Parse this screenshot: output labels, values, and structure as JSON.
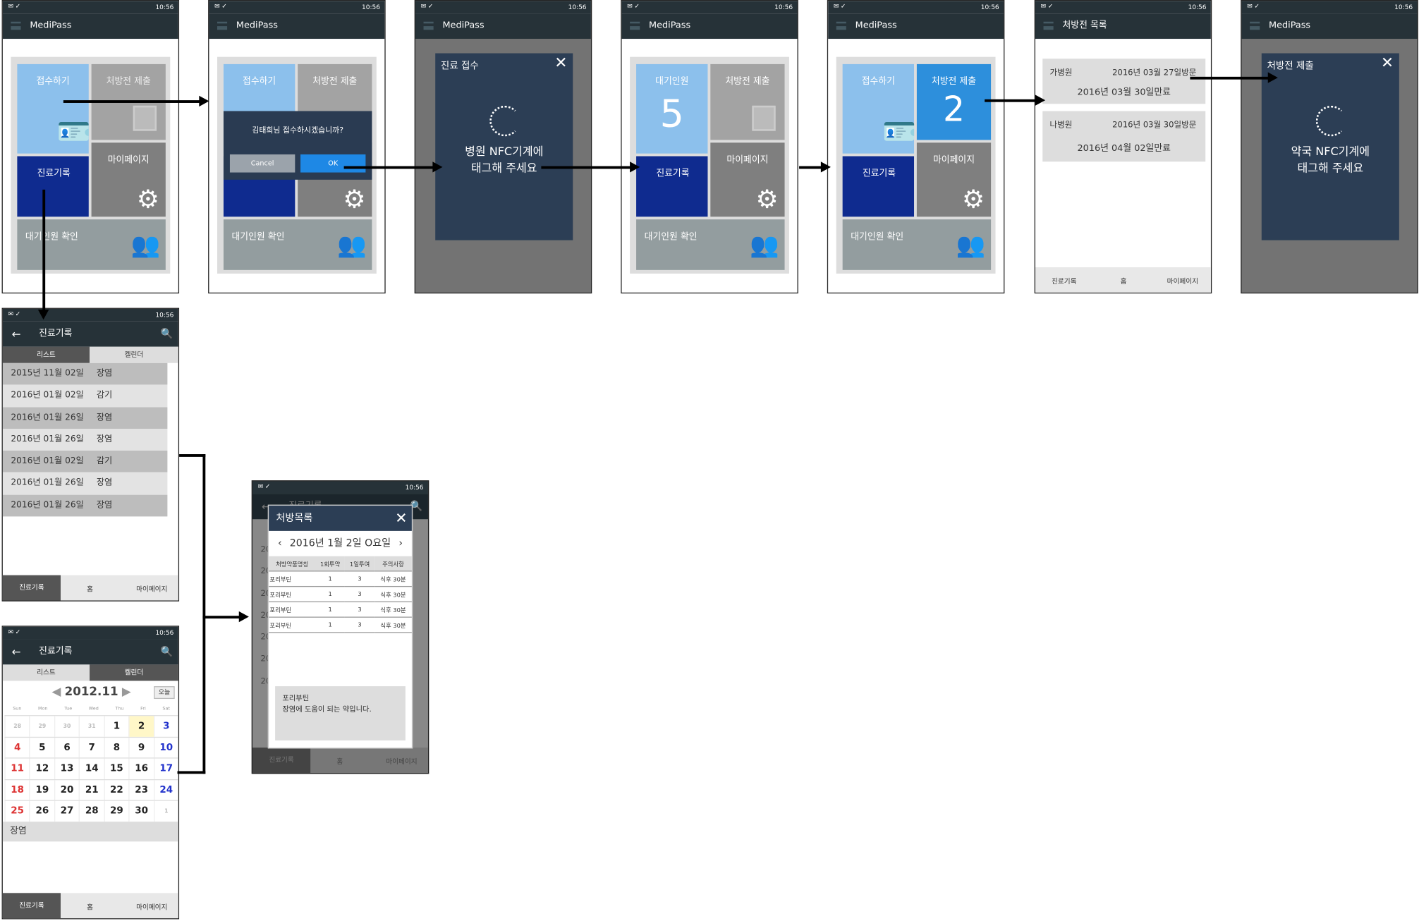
{
  "status_bar": {
    "time": "10:56",
    "left_icons": "✉✓",
    "right_icons": "▼◢ ▮"
  },
  "app": {
    "title": "MediPass"
  },
  "home": {
    "tile_reception": "접수하기",
    "tile_prescription": "처방전 제출",
    "tile_history": "진료기록",
    "tile_mypage": "마이페이지",
    "tile_waiting": "대기인원 확인",
    "tile_waiting_count_label": "대기인원",
    "waiting_count": "5",
    "prescription_count": "2"
  },
  "confirm_dialog": {
    "question": "김태희님 접수하시겠습니까?",
    "cancel": "Cancel",
    "ok": "OK"
  },
  "nfc_hospital": {
    "title": "진료 접수",
    "message_line1": "병원 NFC기계에",
    "message_line2": "태그해 주세요"
  },
  "nfc_pharmacy": {
    "title": "처방전 제출",
    "message_line1": "약국 NFC기계에",
    "message_line2": "태그해 주세요"
  },
  "prescription_list": {
    "title": "처방전 목록",
    "items": [
      {
        "hospital": "가병원",
        "visit": "2016년 03월 27일방문",
        "expire": "2016년 03월 30일만료"
      },
      {
        "hospital": "나병원",
        "visit": "2016년 03월 30일방문",
        "expire": "2016년 04월 02일만료"
      }
    ]
  },
  "bottom_nav": {
    "history": "진료기록",
    "home": "홈",
    "mypage": "마이페이지"
  },
  "history": {
    "title": "진료기록",
    "tab_list": "리스트",
    "tab_calendar": "켈린더",
    "rows": [
      {
        "date": "2015년 11월 02일",
        "diag": "장염"
      },
      {
        "date": "2016년 01월 02일",
        "diag": "감기"
      },
      {
        "date": "2016년 01월 26일",
        "diag": "장염"
      },
      {
        "date": "2016년 01월 26일",
        "diag": "장염"
      },
      {
        "date": "2016년 01월 02일",
        "diag": "감기"
      },
      {
        "date": "2016년 01월 26일",
        "diag": "장염"
      },
      {
        "date": "2016년 01월 26일",
        "diag": "장염"
      }
    ]
  },
  "calendar": {
    "month": "2012.11",
    "today": "오늘",
    "weekdays": [
      "Sun",
      "Mon",
      "Tue",
      "Wed",
      "Thu",
      "Fri",
      "Sat"
    ],
    "weeks": [
      [
        "28",
        "29",
        "30",
        "31",
        "1",
        "2",
        "3"
      ],
      [
        "4",
        "5",
        "6",
        "7",
        "8",
        "9",
        "10"
      ],
      [
        "11",
        "12",
        "13",
        "14",
        "15",
        "16",
        "17"
      ],
      [
        "18",
        "19",
        "20",
        "21",
        "22",
        "23",
        "24"
      ],
      [
        "25",
        "26",
        "27",
        "28",
        "29",
        "30",
        "1"
      ]
    ],
    "selected_diag": "장염"
  },
  "prescription_detail": {
    "bg_title": "진료기록",
    "title": "처방목록",
    "date": "2016년 1월 2일 O요일",
    "headers": [
      "처방약품명칭",
      "1회투약",
      "1일투여",
      "주의사항"
    ],
    "rows": [
      [
        "포리부틴",
        "1",
        "3",
        "식후 30분"
      ],
      [
        "포리부틴",
        "1",
        "3",
        "식후 30분"
      ],
      [
        "포리부틴",
        "1",
        "3",
        "식후 30분"
      ],
      [
        "포리부틴",
        "1",
        "3",
        "식후 30분"
      ]
    ],
    "note_title": "포리부틴",
    "note_text": "장염에 도움이 되는 약입니다.",
    "bg_row_prefix": "20"
  }
}
